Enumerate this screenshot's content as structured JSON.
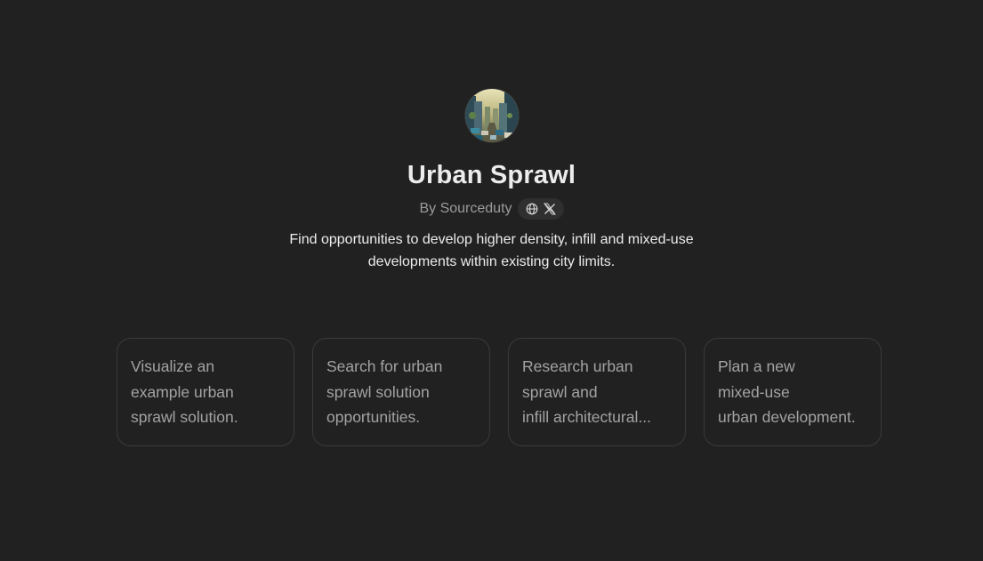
{
  "gpt": {
    "name": "Urban Sprawl",
    "byline": "By Sourceduty",
    "description": "Find opportunities to develop higher density, infill and mixed-use developments within existing city limits.",
    "social_icons": [
      "globe-icon",
      "x-logo-icon"
    ]
  },
  "conversation_starters": [
    {
      "lines": [
        "Visualize an",
        "example urban",
        "sprawl solution."
      ]
    },
    {
      "lines": [
        "Search for urban",
        "sprawl solution",
        "opportunities."
      ]
    },
    {
      "lines": [
        "Research urban",
        "sprawl and",
        "infill architectural..."
      ]
    },
    {
      "lines": [
        "Plan a new",
        "mixed-use",
        "urban development."
      ]
    }
  ],
  "colors": {
    "background": "#212121",
    "text_primary": "#ececec",
    "text_secondary": "#9b9b9b",
    "card_border": "#3a3a3a"
  }
}
